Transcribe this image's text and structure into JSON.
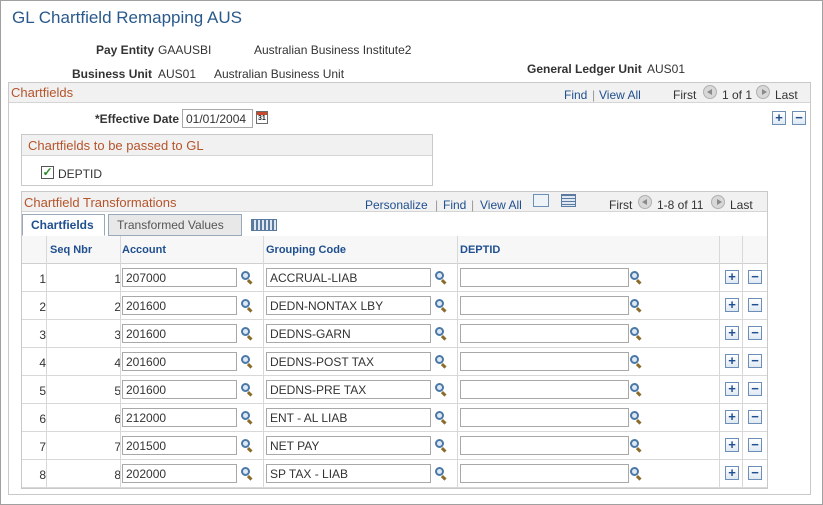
{
  "page": {
    "title": "GL Chartfield Remapping AUS",
    "pay_entity_label": "Pay Entity",
    "pay_entity_code": "GAAUSBI",
    "pay_entity_name": "Australian Business Institute2",
    "business_unit_label": "Business Unit",
    "business_unit_code": "AUS01",
    "business_unit_name": "Australian Business Unit",
    "gl_unit_label": "General Ledger Unit",
    "gl_unit_code": "AUS01"
  },
  "chartfields": {
    "title": "Chartfields",
    "nav": {
      "find": "Find",
      "sep": "|",
      "view_all": "View All",
      "first": "First",
      "range": "1 of 1",
      "last": "Last"
    },
    "effective_date_label": "*Effective Date",
    "effective_date_value": "01/01/2004",
    "calendar_text": "31"
  },
  "passed_to_gl": {
    "title": "Chartfields to be passed to GL",
    "checkbox_label": "DEPTID",
    "checkbox_mark": "✓"
  },
  "transformations": {
    "title": "Chartfield Transformations",
    "nav": {
      "personalize": "Personalize",
      "find": "Find",
      "view_all": "View All",
      "first": "First",
      "range": "1-8 of 11",
      "last": "Last",
      "sep": "|"
    },
    "tabs": [
      "Chartfields",
      "Transformed Values"
    ],
    "columns": {
      "seq_nbr": "Seq Nbr",
      "account": "Account",
      "grouping_code": "Grouping Code",
      "deptid": "DEPTID"
    },
    "rows": [
      {
        "n": "1",
        "seq": "1",
        "account": "207000",
        "grouping": "ACCRUAL-LIAB",
        "deptid": ""
      },
      {
        "n": "2",
        "seq": "2",
        "account": "201600",
        "grouping": "DEDN-NONTAX LBY",
        "deptid": ""
      },
      {
        "n": "3",
        "seq": "3",
        "account": "201600",
        "grouping": "DEDNS-GARN",
        "deptid": ""
      },
      {
        "n": "4",
        "seq": "4",
        "account": "201600",
        "grouping": "DEDNS-POST TAX",
        "deptid": ""
      },
      {
        "n": "5",
        "seq": "5",
        "account": "201600",
        "grouping": "DEDNS-PRE TAX",
        "deptid": ""
      },
      {
        "n": "6",
        "seq": "6",
        "account": "212000",
        "grouping": "ENT - AL LIAB",
        "deptid": ""
      },
      {
        "n": "7",
        "seq": "7",
        "account": "201500",
        "grouping": "NET PAY",
        "deptid": ""
      },
      {
        "n": "8",
        "seq": "8",
        "account": "202000",
        "grouping": "SP TAX - LIAB",
        "deptid": ""
      }
    ],
    "add_symbol": "+",
    "remove_symbol": "−"
  }
}
